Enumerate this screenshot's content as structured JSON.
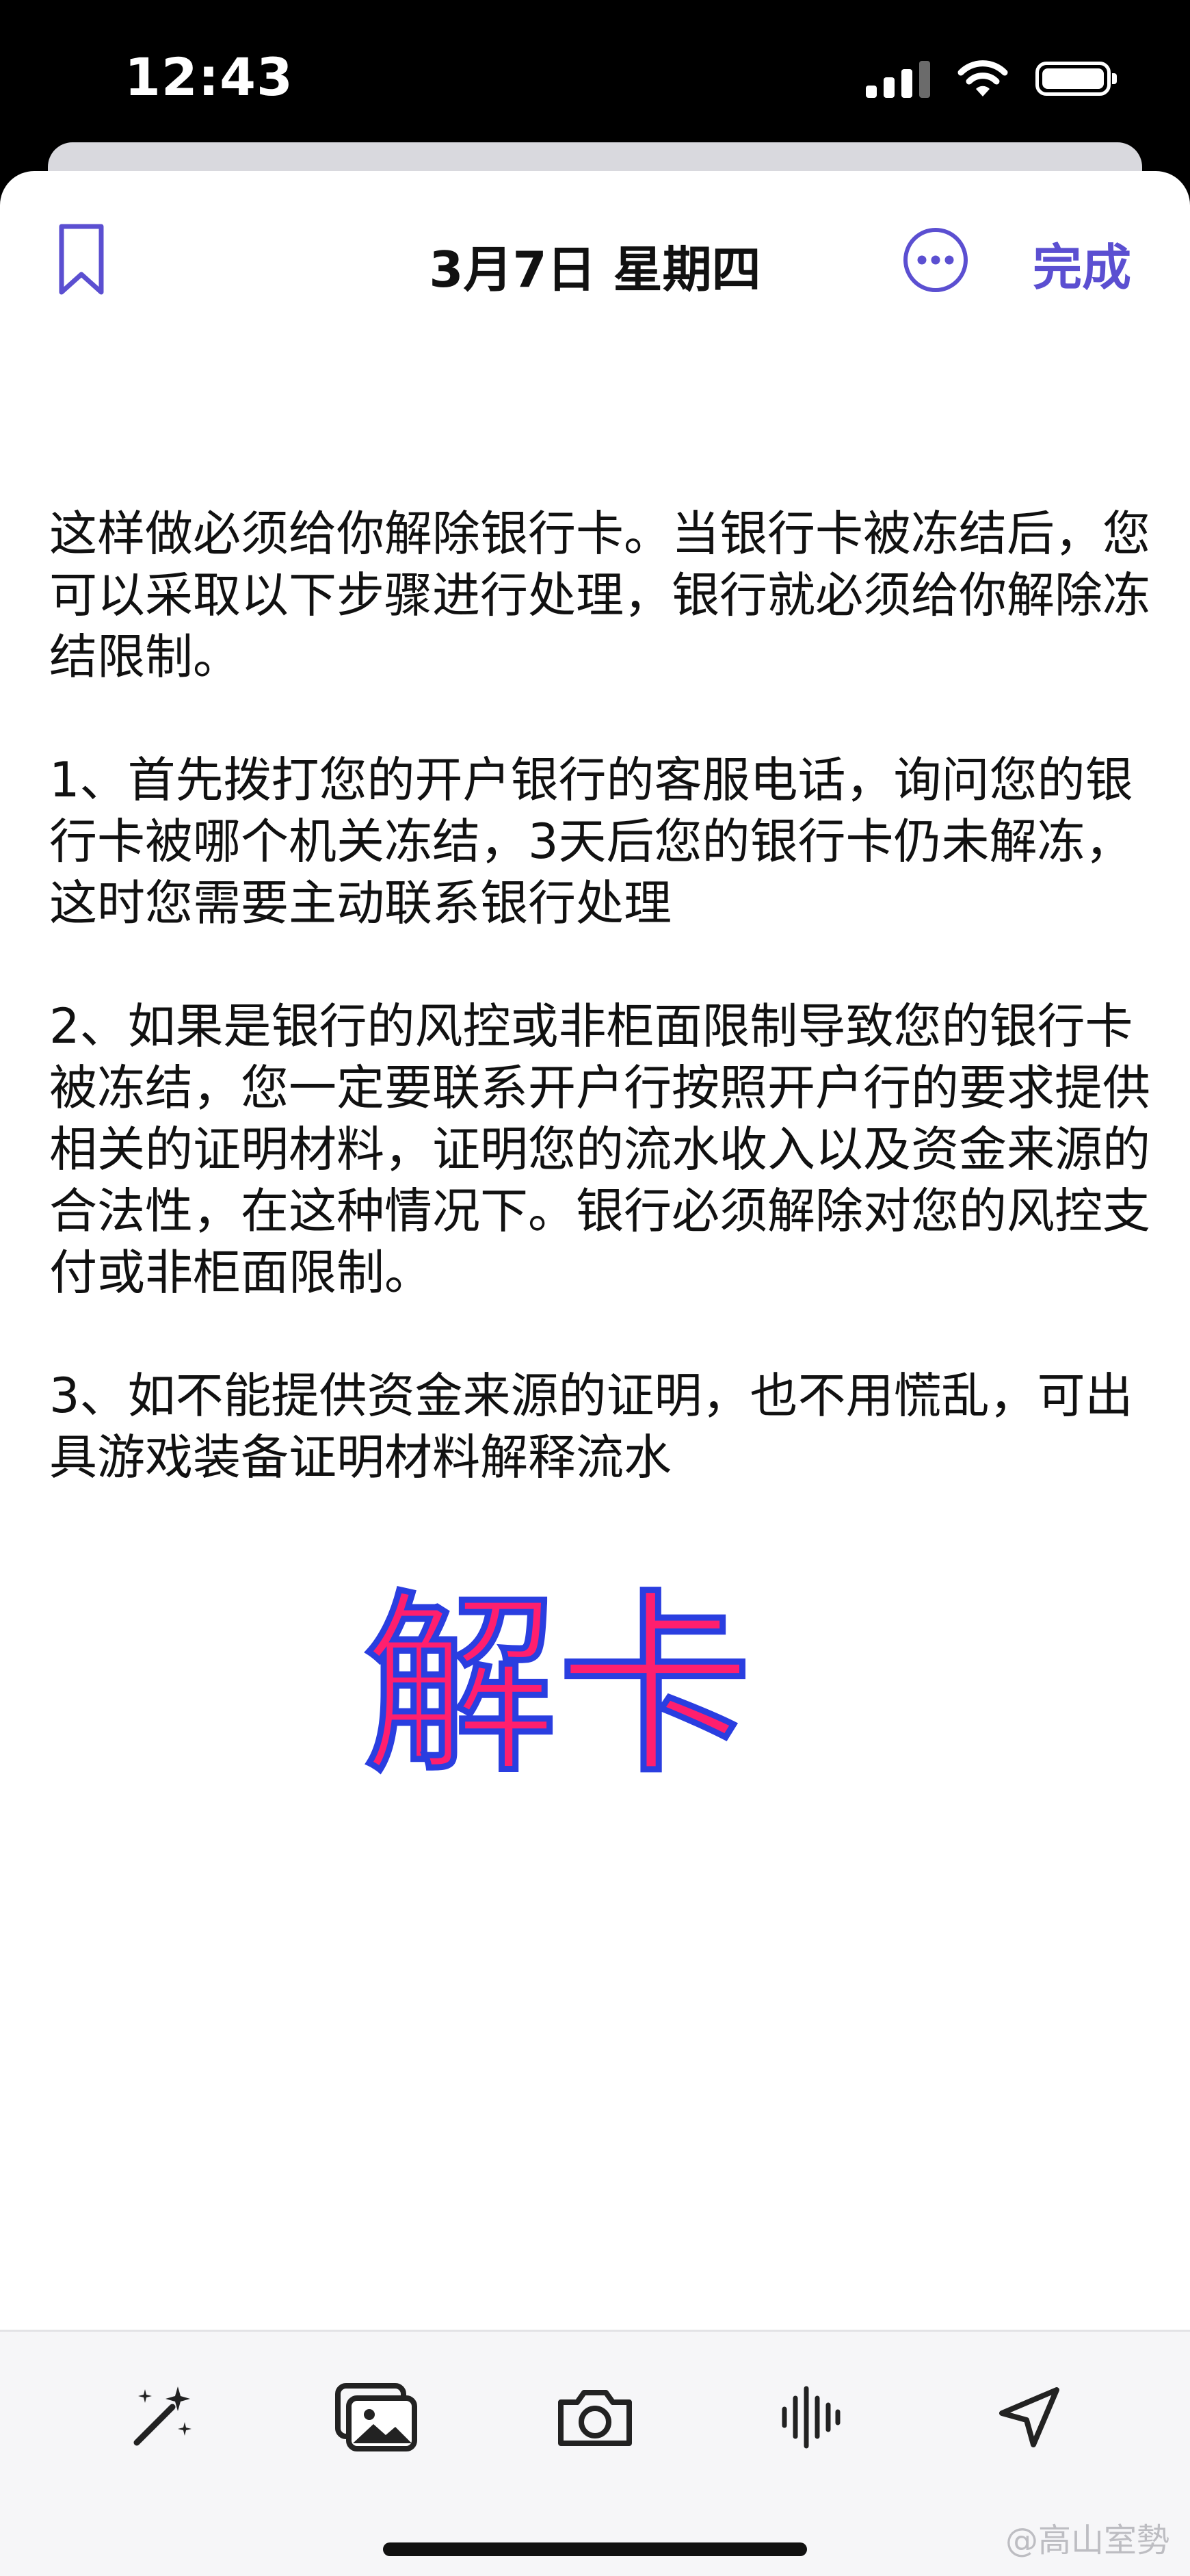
{
  "status_bar": {
    "time": "12:43",
    "icons": [
      "cellular-signal-icon",
      "wifi-icon",
      "battery-icon"
    ]
  },
  "header": {
    "title": "3月7日 星期四",
    "done_label": "完成",
    "icons": [
      "bookmark-icon",
      "more-options-icon"
    ],
    "accent_color": "#5b4fd1"
  },
  "content": {
    "paragraphs": [
      "这样做必须给你解除银行卡。当银行卡被冻结后，您可以采取以下步骤进行处理，银行就必须给你解除冻结限制。",
      "1、首先拨打您的开户银行的客服电话，询问您的银行卡被哪个机关冻结，3天后您的银行卡仍未解冻，这时您需要主动联系银行处理",
      "2、如果是银行的风控或非柜面限制导致您的银行卡被冻结，您一定要联系开户行按照开户行的要求提供相关的证明材料，证明您的流水收入以及资金来源的合法性，在这种情况下。银行必须解除对您的风控支付或非柜面限制。",
      "3、如不能提供资金来源的证明，也不用慌乱，可出具游戏装备证明材料解释流水"
    ],
    "big_label": "解卡",
    "big_label_color": "#ff1f6e",
    "big_label_outline_color": "#2a3ee0"
  },
  "toolbar": {
    "icons": [
      "magic-wand-icon",
      "photo-library-icon",
      "camera-icon",
      "audio-waveform-icon",
      "location-arrow-icon"
    ]
  },
  "watermark": {
    "text": "@高山室勢"
  }
}
